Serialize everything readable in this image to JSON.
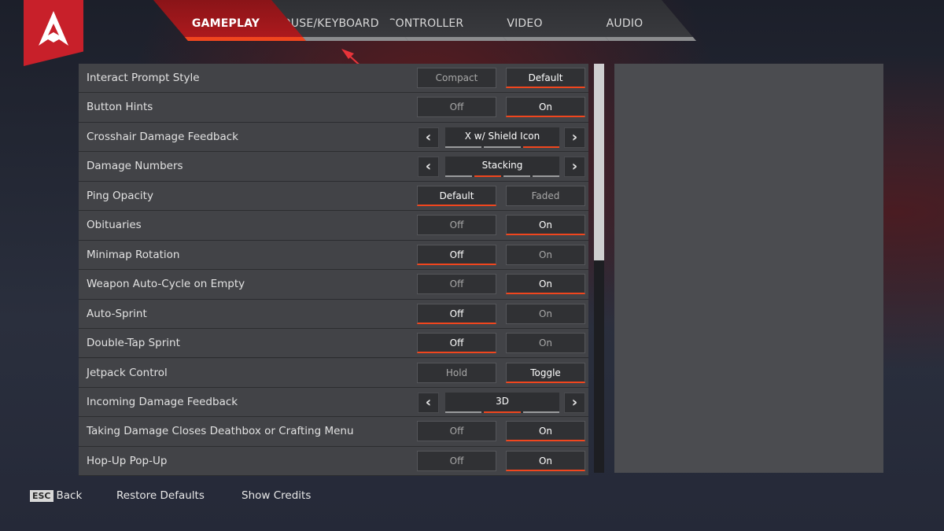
{
  "colors": {
    "accent": "#f0461e",
    "brand_red": "#c8202a"
  },
  "logo": {
    "icon": "apex-legends-logo"
  },
  "tabs": [
    {
      "label": "GAMEPLAY",
      "active": true
    },
    {
      "label": "MOUSE/KEYBOARD",
      "active": false
    },
    {
      "label": "CONTROLLER",
      "active": false
    },
    {
      "label": "VIDEO",
      "active": false
    },
    {
      "label": "AUDIO",
      "active": false
    }
  ],
  "annotation": {
    "icon": "red-arrow-pointing-to-mouse-keyboard-tab"
  },
  "settings": [
    {
      "label": "Interact Prompt Style",
      "type": "toggle",
      "options": [
        "Compact",
        "Default"
      ],
      "selected": 1
    },
    {
      "label": "Button Hints",
      "type": "toggle",
      "options": [
        "Off",
        "On"
      ],
      "selected": 1
    },
    {
      "label": "Crosshair Damage Feedback",
      "type": "selector",
      "value": "X w/ Shield Icon",
      "segments": 3,
      "selected": 2
    },
    {
      "label": "Damage Numbers",
      "type": "selector",
      "value": "Stacking",
      "segments": 4,
      "selected": 1
    },
    {
      "label": "Ping Opacity",
      "type": "toggle",
      "options": [
        "Default",
        "Faded"
      ],
      "selected": 0
    },
    {
      "label": "Obituaries",
      "type": "toggle",
      "options": [
        "Off",
        "On"
      ],
      "selected": 1
    },
    {
      "label": "Minimap Rotation",
      "type": "toggle",
      "options": [
        "Off",
        "On"
      ],
      "selected": 0
    },
    {
      "label": "Weapon Auto-Cycle on Empty",
      "type": "toggle",
      "options": [
        "Off",
        "On"
      ],
      "selected": 1
    },
    {
      "label": "Auto-Sprint",
      "type": "toggle",
      "options": [
        "Off",
        "On"
      ],
      "selected": 0
    },
    {
      "label": "Double-Tap Sprint",
      "type": "toggle",
      "options": [
        "Off",
        "On"
      ],
      "selected": 0
    },
    {
      "label": "Jetpack Control",
      "type": "toggle",
      "options": [
        "Hold",
        "Toggle"
      ],
      "selected": 1
    },
    {
      "label": "Incoming Damage Feedback",
      "type": "selector",
      "value": "3D",
      "segments": 3,
      "selected": 1
    },
    {
      "label": "Taking Damage Closes Deathbox or Crafting Menu",
      "type": "toggle",
      "options": [
        "Off",
        "On"
      ],
      "selected": 1
    },
    {
      "label": "Hop-Up Pop-Up",
      "type": "toggle",
      "options": [
        "Off",
        "On"
      ],
      "selected": 1
    }
  ],
  "scrollbar": {
    "position_percent": 0,
    "visible_fraction": 0.48
  },
  "footer": {
    "esc_key": "ESC",
    "back": "Back",
    "restore": "Restore Defaults",
    "credits": "Show Credits"
  }
}
